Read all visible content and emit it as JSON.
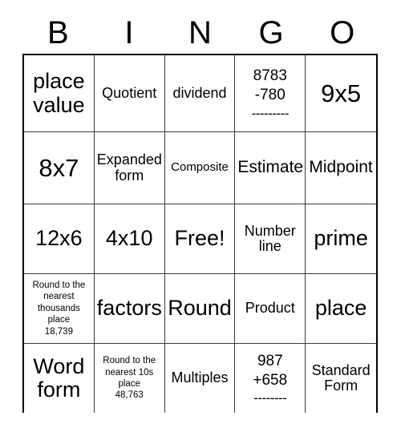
{
  "card": {
    "title": "BINGO Card",
    "header_letters": [
      "B",
      "I",
      "N",
      "G",
      "O"
    ],
    "columns": 5,
    "rows": 5,
    "colors": {
      "background": "#ffffff",
      "text": "#000000",
      "grid_line": "#3b3b3b",
      "outer_border": "#000000"
    },
    "free_space": "Free!",
    "cells": [
      {
        "id": "b1",
        "text": "place\nvalue",
        "size": "xl"
      },
      {
        "id": "i1",
        "text": "Quotient",
        "size": "m"
      },
      {
        "id": "n1",
        "text": "dividend",
        "size": "m"
      },
      {
        "id": "g1",
        "text": "8783\n-780",
        "rule": "---------",
        "size": "problem"
      },
      {
        "id": "o1",
        "text": "9x5",
        "size": "xxl"
      },
      {
        "id": "b2",
        "text": "8x7",
        "size": "xxl"
      },
      {
        "id": "i2",
        "text": "Expanded\nform",
        "size": "m"
      },
      {
        "id": "n2",
        "text": "Composite",
        "size": "s"
      },
      {
        "id": "g2",
        "text": "Estimate",
        "size": "l"
      },
      {
        "id": "o2",
        "text": "Midpoint",
        "size": "l"
      },
      {
        "id": "b3",
        "text": "12x6",
        "size": "xl"
      },
      {
        "id": "i3",
        "text": "4x10",
        "size": "xl"
      },
      {
        "id": "n3",
        "text": "Free!",
        "size": "xl"
      },
      {
        "id": "g3",
        "text": "Number\nline",
        "size": "m"
      },
      {
        "id": "o3",
        "text": "prime",
        "size": "xl"
      },
      {
        "id": "b4",
        "text": "Round to the\nnearest\nthousands\nplace\n18,739",
        "size": "xs"
      },
      {
        "id": "i4",
        "text": "factors",
        "size": "xl"
      },
      {
        "id": "n4",
        "text": "Round",
        "size": "xl"
      },
      {
        "id": "g4",
        "text": "Product",
        "size": "m"
      },
      {
        "id": "o4",
        "text": "place",
        "size": "xl"
      },
      {
        "id": "b5",
        "text": "Word\nform",
        "size": "xl"
      },
      {
        "id": "i5",
        "text": "Round to the\nnearest 10s\nplace\n48,763",
        "size": "xs"
      },
      {
        "id": "n5",
        "text": "Multiples",
        "size": "m"
      },
      {
        "id": "g5",
        "text": "987\n+658",
        "rule": "--------",
        "size": "problem"
      },
      {
        "id": "o5",
        "text": "Standard\nForm",
        "size": "m"
      }
    ]
  }
}
